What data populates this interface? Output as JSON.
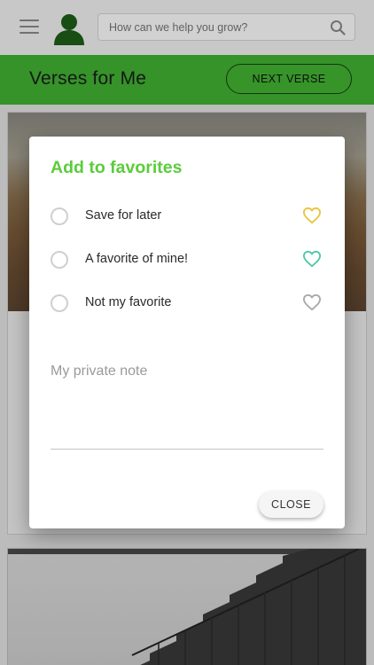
{
  "search": {
    "placeholder": "How can we help you grow?"
  },
  "header": {
    "title": "Verses for Me",
    "next_label": "NEXT VERSE"
  },
  "dialog": {
    "title": "Add to favorites",
    "options": [
      {
        "label": "Save for later",
        "heart_color": "#e8c43a"
      },
      {
        "label": "A favorite of mine!",
        "heart_color": "#4cc7a5"
      },
      {
        "label": "Not my favorite",
        "heart_color": "#a8a8a8"
      }
    ],
    "note_placeholder": "My private note",
    "close_label": "CLOSE"
  },
  "colors": {
    "brand_green": "#41b432",
    "title_green": "#5ccc3c",
    "avatar_green": "#1e5e18"
  }
}
